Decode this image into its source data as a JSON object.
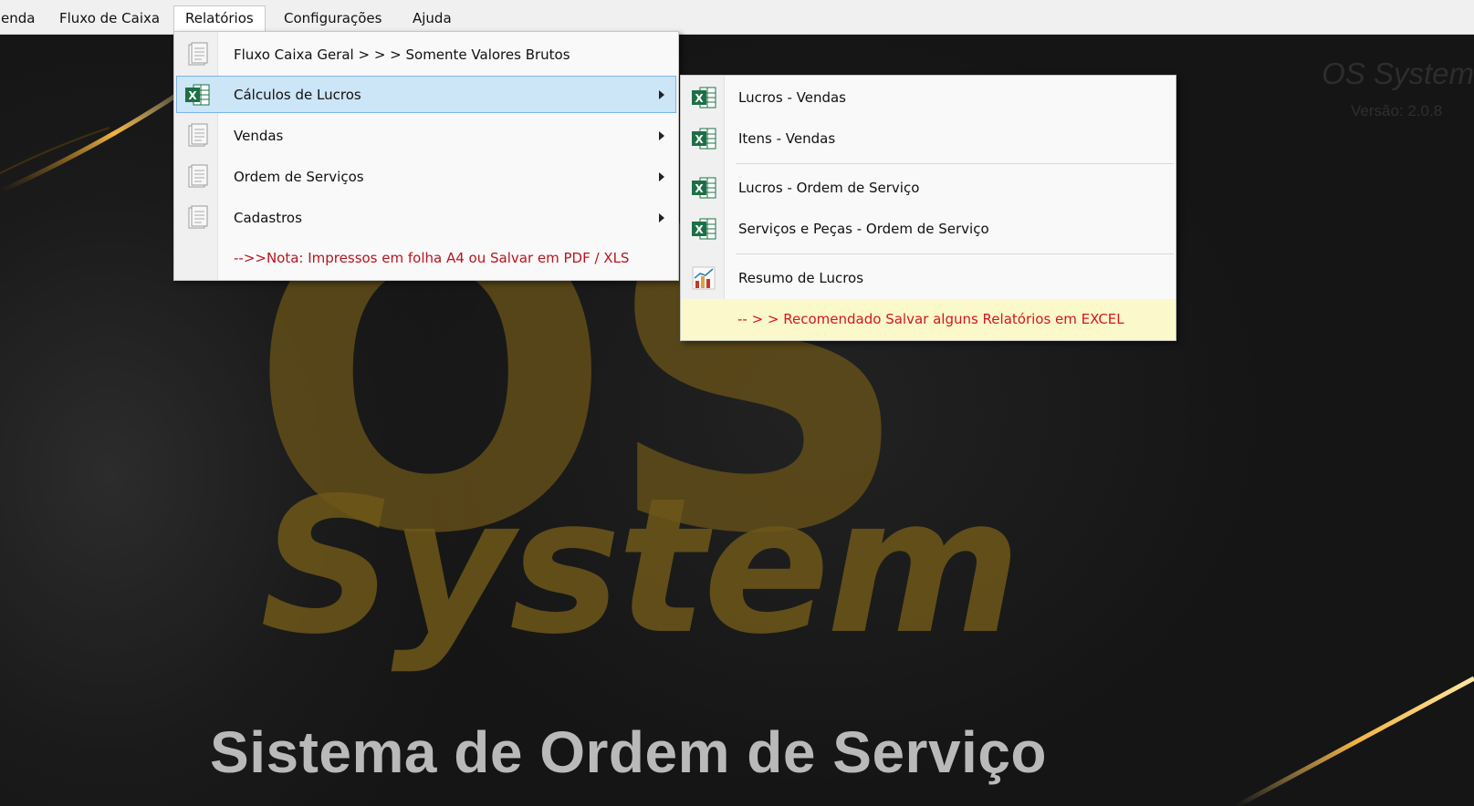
{
  "menubar": {
    "items": [
      {
        "label": "enda"
      },
      {
        "label": "Fluxo de Caixa"
      },
      {
        "label": "Relatórios"
      },
      {
        "label": "Configurações"
      },
      {
        "label": "Ajuda"
      }
    ],
    "active_index": 2
  },
  "relatorios_menu": {
    "items": [
      {
        "label": "Fluxo Caixa Geral > > > Somente Valores Brutos",
        "icon": "document-icon"
      },
      {
        "label": "Cálculos de Lucros",
        "icon": "excel-icon",
        "submenu": true,
        "highlighted": true
      },
      {
        "label": "Vendas",
        "icon": "document-icon",
        "submenu": true
      },
      {
        "label": "Ordem de Serviços",
        "icon": "document-icon",
        "submenu": true
      },
      {
        "label": "Cadastros",
        "icon": "document-icon",
        "submenu": true
      },
      {
        "label": "-->>Nota: Impressos em folha A4 ou Salvar em PDF / XLS",
        "note": true
      }
    ]
  },
  "lucros_submenu": {
    "items": [
      {
        "label": "Lucros - Vendas",
        "icon": "excel-icon"
      },
      {
        "label": "Itens - Vendas",
        "icon": "excel-icon"
      },
      {
        "label": "Lucros - Ordem de Serviço",
        "icon": "excel-icon"
      },
      {
        "label": "Serviços e Peças -  Ordem de Serviço",
        "icon": "excel-icon"
      },
      {
        "label": "Resumo de Lucros",
        "icon": "bar-chart-icon"
      },
      {
        "label": "-- > > Recomendado Salvar alguns Relatórios em EXCEL",
        "note": true
      }
    ]
  },
  "splash": {
    "big_letters": "OS",
    "big_word": "System",
    "tagline": "Sistema de Ordem de Serviço",
    "corner_title": "OS System",
    "version": "Versão: 2.0.8"
  },
  "colors": {
    "highlight": "#cce5f7",
    "highlight_border": "#7eb4ea",
    "note_red": "#b8141d",
    "warn_bg": "#fbf8cc",
    "excel_green": "#1d7045",
    "gold": "#6e5719"
  }
}
